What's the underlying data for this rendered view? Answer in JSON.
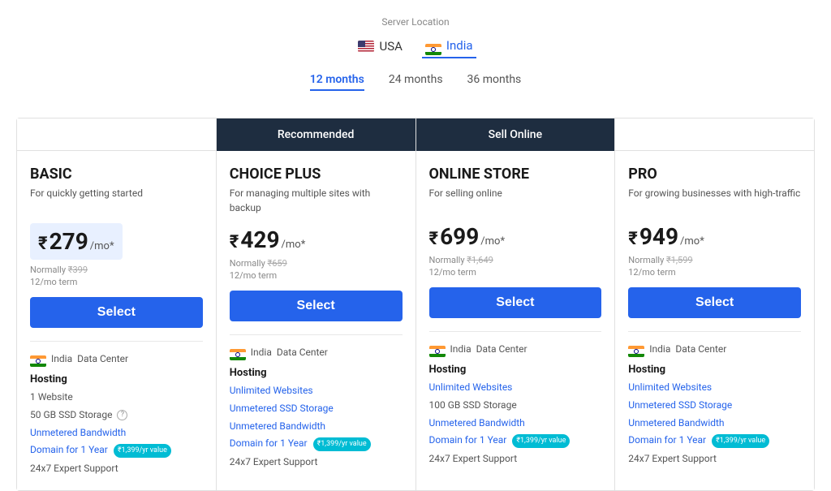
{
  "header": {
    "server_location_label": "Server Location",
    "locations": [
      {
        "id": "usa",
        "label": "USA",
        "flag": "usa",
        "active": false
      },
      {
        "id": "india",
        "label": "India",
        "flag": "india",
        "active": true
      }
    ],
    "durations": [
      {
        "id": "12",
        "label": "12 months",
        "active": true
      },
      {
        "id": "24",
        "label": "24 months",
        "active": false
      },
      {
        "id": "36",
        "label": "36 months",
        "active": false
      }
    ]
  },
  "plans": [
    {
      "id": "basic",
      "badge": "",
      "name": "BASIC",
      "desc": "For quickly getting started",
      "price": "279",
      "currency": "₹",
      "period": "/mo*",
      "normally_label": "Normally",
      "normally_price": "₹399",
      "term": "12/mo term",
      "select_label": "Select",
      "data_center": "India",
      "hosting_label": "Hosting",
      "features": [
        {
          "text": "1 Website",
          "link": false
        },
        {
          "text": "50 GB SSD Storage",
          "link": false,
          "info": true
        },
        {
          "text": "Unmetered Bandwidth",
          "link": true
        },
        {
          "text": "Domain for 1 Year",
          "link": true,
          "badge": "₹1,399/yr value"
        },
        {
          "text": "24x7 Expert Support",
          "link": false
        }
      ],
      "highlighted": true
    },
    {
      "id": "choice_plus",
      "badge": "Recommended",
      "name": "CHOICE PLUS",
      "desc": "For managing multiple sites with backup",
      "price": "429",
      "currency": "₹",
      "period": "/mo*",
      "normally_label": "Normally",
      "normally_price": "₹659",
      "term": "12/mo term",
      "select_label": "Select",
      "data_center": "India",
      "hosting_label": "Hosting",
      "features": [
        {
          "text": "Unlimited Websites",
          "link": true
        },
        {
          "text": "Unmetered SSD Storage",
          "link": true
        },
        {
          "text": "Unmetered Bandwidth",
          "link": true
        },
        {
          "text": "Domain for 1 Year",
          "link": true,
          "badge": "₹1,399/yr value"
        },
        {
          "text": "24x7 Expert Support",
          "link": false
        }
      ],
      "highlighted": false
    },
    {
      "id": "online_store",
      "badge": "Sell Online",
      "name": "ONLINE STORE",
      "desc": "For selling online",
      "price": "699",
      "currency": "₹",
      "period": "/mo*",
      "normally_label": "Normally",
      "normally_price": "₹1,649",
      "term": "12/mo term",
      "select_label": "Select",
      "data_center": "India",
      "hosting_label": "Hosting",
      "features": [
        {
          "text": "Unlimited Websites",
          "link": true
        },
        {
          "text": "100 GB SSD Storage",
          "link": false
        },
        {
          "text": "Unmetered Bandwidth",
          "link": true
        },
        {
          "text": "Domain for 1 Year",
          "link": true,
          "badge": "₹1,399/yr value"
        },
        {
          "text": "24x7 Expert Support",
          "link": false
        }
      ],
      "highlighted": false
    },
    {
      "id": "pro",
      "badge": "",
      "name": "PRO",
      "desc": "For growing businesses with high-traffic",
      "price": "949",
      "currency": "₹",
      "period": "/mo*",
      "normally_label": "Normally",
      "normally_price": "₹1,599",
      "term": "12/mo term",
      "select_label": "Select",
      "data_center": "India",
      "hosting_label": "Hosting",
      "features": [
        {
          "text": "Unlimited Websites",
          "link": true
        },
        {
          "text": "Unmetered SSD Storage",
          "link": true
        },
        {
          "text": "Unmetered Bandwidth",
          "link": true
        },
        {
          "text": "Domain for 1 Year",
          "link": true,
          "badge": "₹1,399/yr value"
        },
        {
          "text": "24x7 Expert Support",
          "link": false
        }
      ],
      "highlighted": false
    }
  ]
}
